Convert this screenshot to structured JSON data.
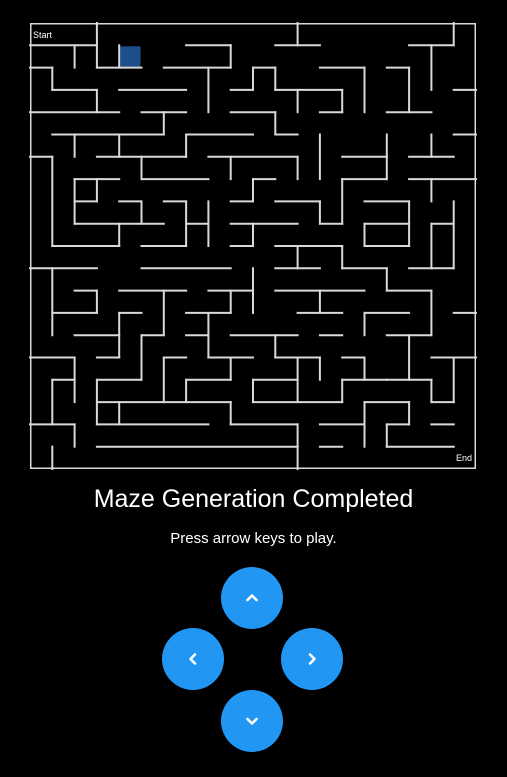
{
  "maze": {
    "start_label": "Start",
    "end_label": "End",
    "grid_size": 20,
    "player": {
      "row": 1,
      "col": 4
    },
    "wall_color": "#d9d9d9",
    "player_color": "#1f4e8c",
    "walls": [
      [
        3,
        0,
        3,
        2
      ],
      [
        12,
        0,
        12,
        1
      ],
      [
        19,
        0,
        19,
        1
      ],
      [
        0,
        1,
        3,
        1
      ],
      [
        7,
        1,
        9,
        1
      ],
      [
        11,
        1,
        13,
        1
      ],
      [
        17,
        1,
        19,
        1
      ],
      [
        2,
        1,
        2,
        2
      ],
      [
        4,
        1,
        4,
        2
      ],
      [
        9,
        1,
        9,
        2
      ],
      [
        18,
        1,
        18,
        3
      ],
      [
        0,
        2,
        1,
        2
      ],
      [
        3,
        2,
        5,
        2
      ],
      [
        6,
        2,
        9,
        2
      ],
      [
        10,
        2,
        11,
        2
      ],
      [
        13,
        2,
        15,
        2
      ],
      [
        16,
        2,
        17,
        2
      ],
      [
        1,
        2,
        1,
        3
      ],
      [
        8,
        2,
        8,
        4
      ],
      [
        10,
        2,
        10,
        3
      ],
      [
        11,
        2,
        11,
        3
      ],
      [
        15,
        2,
        15,
        4
      ],
      [
        17,
        2,
        17,
        4
      ],
      [
        1,
        3,
        3,
        3
      ],
      [
        4,
        3,
        7,
        3
      ],
      [
        9,
        3,
        10,
        3
      ],
      [
        11,
        3,
        14,
        3
      ],
      [
        19,
        3,
        20,
        3
      ],
      [
        3,
        3,
        3,
        4
      ],
      [
        12,
        3,
        12,
        4
      ],
      [
        14,
        3,
        14,
        4
      ],
      [
        0,
        4,
        4,
        4
      ],
      [
        5,
        4,
        7,
        4
      ],
      [
        9,
        4,
        11,
        4
      ],
      [
        13,
        4,
        14,
        4
      ],
      [
        16,
        4,
        18,
        4
      ],
      [
        6,
        4,
        6,
        5
      ],
      [
        11,
        4,
        11,
        5
      ],
      [
        1,
        5,
        6,
        5
      ],
      [
        7,
        5,
        10,
        5
      ],
      [
        11,
        5,
        12,
        5
      ],
      [
        19,
        5,
        20,
        5
      ],
      [
        2,
        5,
        2,
        6
      ],
      [
        4,
        5,
        4,
        6
      ],
      [
        7,
        5,
        7,
        6
      ],
      [
        13,
        5,
        13,
        7
      ],
      [
        16,
        5,
        16,
        7
      ],
      [
        18,
        5,
        18,
        6
      ],
      [
        0,
        6,
        1,
        6
      ],
      [
        3,
        6,
        7,
        6
      ],
      [
        8,
        6,
        12,
        6
      ],
      [
        14,
        6,
        16,
        6
      ],
      [
        17,
        6,
        19,
        6
      ],
      [
        1,
        6,
        1,
        10
      ],
      [
        5,
        6,
        5,
        7
      ],
      [
        9,
        6,
        9,
        7
      ],
      [
        12,
        6,
        12,
        7
      ],
      [
        2,
        7,
        4,
        7
      ],
      [
        5,
        7,
        8,
        7
      ],
      [
        10,
        7,
        11,
        7
      ],
      [
        14,
        7,
        16,
        7
      ],
      [
        17,
        7,
        20,
        7
      ],
      [
        2,
        7,
        2,
        9
      ],
      [
        3,
        7,
        3,
        8
      ],
      [
        10,
        7,
        10,
        8
      ],
      [
        14,
        7,
        14,
        9
      ],
      [
        18,
        7,
        18,
        8
      ],
      [
        2,
        8,
        3,
        8
      ],
      [
        4,
        8,
        5,
        8
      ],
      [
        6,
        8,
        7,
        8
      ],
      [
        9,
        8,
        10,
        8
      ],
      [
        11,
        8,
        13,
        8
      ],
      [
        15,
        8,
        17,
        8
      ],
      [
        5,
        8,
        5,
        9
      ],
      [
        7,
        8,
        7,
        10
      ],
      [
        8,
        8,
        8,
        10
      ],
      [
        13,
        8,
        13,
        9
      ],
      [
        17,
        8,
        17,
        10
      ],
      [
        19,
        8,
        19,
        11
      ],
      [
        2,
        9,
        6,
        9
      ],
      [
        7,
        9,
        8,
        9
      ],
      [
        9,
        9,
        12,
        9
      ],
      [
        13,
        9,
        14,
        9
      ],
      [
        15,
        9,
        17,
        9
      ],
      [
        18,
        9,
        19,
        9
      ],
      [
        4,
        9,
        4,
        10
      ],
      [
        10,
        9,
        10,
        10
      ],
      [
        15,
        9,
        15,
        10
      ],
      [
        18,
        9,
        18,
        11
      ],
      [
        1,
        10,
        4,
        10
      ],
      [
        5,
        10,
        7,
        10
      ],
      [
        9,
        10,
        10,
        10
      ],
      [
        11,
        10,
        14,
        10
      ],
      [
        15,
        10,
        17,
        10
      ],
      [
        12,
        10,
        12,
        11
      ],
      [
        14,
        10,
        14,
        11
      ],
      [
        0,
        11,
        3,
        11
      ],
      [
        5,
        11,
        9,
        11
      ],
      [
        11,
        11,
        13,
        11
      ],
      [
        14,
        11,
        16,
        11
      ],
      [
        17,
        11,
        19,
        11
      ],
      [
        1,
        11,
        1,
        14
      ],
      [
        10,
        11,
        10,
        13
      ],
      [
        16,
        11,
        16,
        12
      ],
      [
        2,
        12,
        3,
        12
      ],
      [
        4,
        12,
        7,
        12
      ],
      [
        8,
        12,
        10,
        12
      ],
      [
        11,
        12,
        15,
        12
      ],
      [
        16,
        12,
        18,
        12
      ],
      [
        3,
        12,
        3,
        13
      ],
      [
        6,
        12,
        6,
        14
      ],
      [
        9,
        12,
        9,
        13
      ],
      [
        13,
        12,
        13,
        13
      ],
      [
        18,
        12,
        18,
        14
      ],
      [
        1,
        13,
        3,
        13
      ],
      [
        4,
        13,
        5,
        13
      ],
      [
        7,
        13,
        9,
        13
      ],
      [
        12,
        13,
        14,
        13
      ],
      [
        15,
        13,
        17,
        13
      ],
      [
        19,
        13,
        20,
        13
      ],
      [
        4,
        13,
        4,
        15
      ],
      [
        8,
        13,
        8,
        15
      ],
      [
        15,
        13,
        15,
        14
      ],
      [
        2,
        14,
        4,
        14
      ],
      [
        5,
        14,
        6,
        14
      ],
      [
        7,
        14,
        8,
        14
      ],
      [
        9,
        14,
        12,
        14
      ],
      [
        13,
        14,
        14,
        14
      ],
      [
        16,
        14,
        18,
        14
      ],
      [
        5,
        14,
        5,
        16
      ],
      [
        11,
        14,
        11,
        15
      ],
      [
        17,
        14,
        17,
        16
      ],
      [
        0,
        15,
        2,
        15
      ],
      [
        3,
        15,
        4,
        15
      ],
      [
        6,
        15,
        7,
        15
      ],
      [
        8,
        15,
        10,
        15
      ],
      [
        11,
        15,
        13,
        15
      ],
      [
        14,
        15,
        15,
        15
      ],
      [
        18,
        15,
        20,
        15
      ],
      [
        2,
        15,
        2,
        17
      ],
      [
        6,
        15,
        6,
        17
      ],
      [
        9,
        15,
        9,
        16
      ],
      [
        12,
        15,
        12,
        17
      ],
      [
        13,
        15,
        13,
        16
      ],
      [
        15,
        15,
        15,
        16
      ],
      [
        19,
        15,
        19,
        17
      ],
      [
        1,
        16,
        2,
        16
      ],
      [
        3,
        16,
        5,
        16
      ],
      [
        7,
        16,
        9,
        16
      ],
      [
        10,
        16,
        12,
        16
      ],
      [
        14,
        16,
        16,
        16
      ],
      [
        16,
        16,
        18,
        16
      ],
      [
        1,
        16,
        1,
        18
      ],
      [
        3,
        16,
        3,
        18
      ],
      [
        7,
        16,
        7,
        17
      ],
      [
        10,
        16,
        10,
        17
      ],
      [
        14,
        16,
        14,
        17
      ],
      [
        18,
        16,
        18,
        17
      ],
      [
        3,
        17,
        9,
        17
      ],
      [
        10,
        17,
        14,
        17
      ],
      [
        15,
        17,
        17,
        17
      ],
      [
        18,
        17,
        19,
        17
      ],
      [
        4,
        17,
        4,
        18
      ],
      [
        9,
        17,
        9,
        18
      ],
      [
        15,
        17,
        15,
        19
      ],
      [
        17,
        17,
        17,
        18
      ],
      [
        0,
        18,
        2,
        18
      ],
      [
        3,
        18,
        8,
        18
      ],
      [
        9,
        18,
        12,
        18
      ],
      [
        13,
        18,
        15,
        18
      ],
      [
        16,
        18,
        17,
        18
      ],
      [
        18,
        18,
        19,
        18
      ],
      [
        2,
        18,
        2,
        19
      ],
      [
        12,
        18,
        12,
        19
      ],
      [
        16,
        18,
        16,
        19
      ],
      [
        3,
        19,
        12,
        19
      ],
      [
        13,
        19,
        14,
        19
      ],
      [
        16,
        19,
        19,
        19
      ],
      [
        1,
        19,
        1,
        20
      ],
      [
        12,
        19,
        12,
        20
      ]
    ]
  },
  "status": {
    "title": "Maze Generation Completed",
    "instruction": "Press arrow keys to play."
  },
  "controls": {
    "button_color": "#2196f3",
    "icon_color": "#ffffff",
    "buttons": [
      {
        "name": "up",
        "icon": "chevron-up-icon"
      },
      {
        "name": "left",
        "icon": "chevron-left-icon"
      },
      {
        "name": "right",
        "icon": "chevron-right-icon"
      },
      {
        "name": "down",
        "icon": "chevron-down-icon"
      }
    ]
  }
}
